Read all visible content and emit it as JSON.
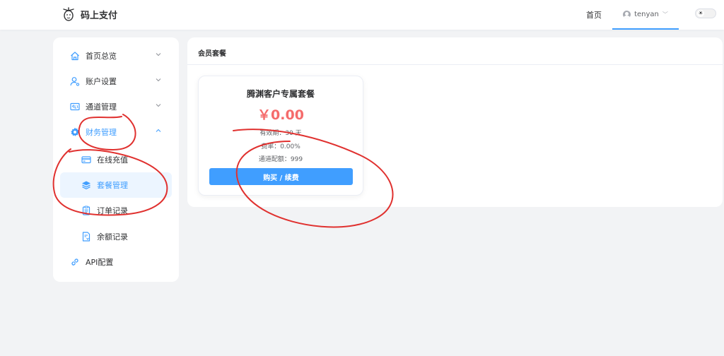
{
  "header": {
    "brand": "码上支付",
    "nav_home": "首页",
    "user_name": "tenyan",
    "user_caret": "﹀",
    "theme_toggle_icon": "sun-icon",
    "accent": "#409eff"
  },
  "sidebar": {
    "items": [
      {
        "label": "首页总览",
        "icon": "home-icon"
      },
      {
        "label": "账户设置",
        "icon": "user-settings-icon"
      },
      {
        "label": "通道管理",
        "icon": "channel-icon"
      },
      {
        "label": "财务管理",
        "icon": "gear-icon"
      },
      {
        "label": "在线充值",
        "icon": "credit-card-icon"
      },
      {
        "label": "套餐管理",
        "icon": "layers-icon"
      },
      {
        "label": "订单记录",
        "icon": "clipboard-icon"
      },
      {
        "label": "余额记录",
        "icon": "document-icon"
      },
      {
        "label": "API配置",
        "icon": "link-icon"
      }
    ]
  },
  "main": {
    "title": "会员套餐",
    "plan": {
      "name": "腾渊客户专属套餐",
      "price": "￥0.00",
      "validity": "有效期：30 天",
      "rate": "费率：0.00%",
      "quota": "通道配额：999",
      "button": "购买 / 续费"
    }
  },
  "colors": {
    "primary": "#409eff",
    "price": "#f56c6c",
    "annotation": "#e0312f"
  }
}
